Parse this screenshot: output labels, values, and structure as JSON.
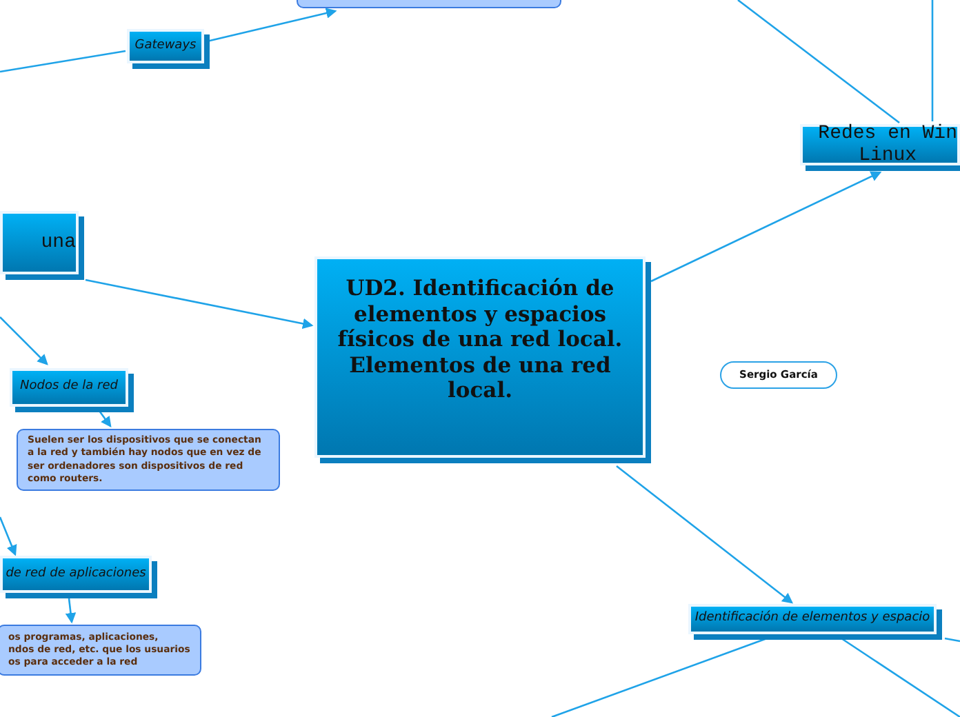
{
  "nodes": [
    {
      "kind": "subtopic",
      "text": "Gateways"
    },
    {
      "kind": "note"
    },
    {
      "kind": "topic",
      "text": "una"
    },
    {
      "kind": "subtopic",
      "text": "Nodos de la red"
    },
    {
      "kind": "note",
      "text": "Suelen ser los dispositivos que se conectan a la red y también hay nodos que en vez de ser ordenadores son dispositivos de red como routers."
    },
    {
      "kind": "subtopic",
      "text": "de red de aplicaciones"
    },
    {
      "kind": "note",
      "text": "os programas, aplicaciones,\nndos de red, etc. que los usuarios\nos para acceder a la red"
    },
    {
      "kind": "central",
      "text": "UD2. Identificación de elementos y espacios físicos de una red local. Elementos de una red local."
    },
    {
      "kind": "topic",
      "text": "Redes en Win\nLinux"
    },
    {
      "kind": "label",
      "text": "Sergio García"
    },
    {
      "kind": "subtopic",
      "text": "Identificación de elementos y espacio"
    }
  ]
}
